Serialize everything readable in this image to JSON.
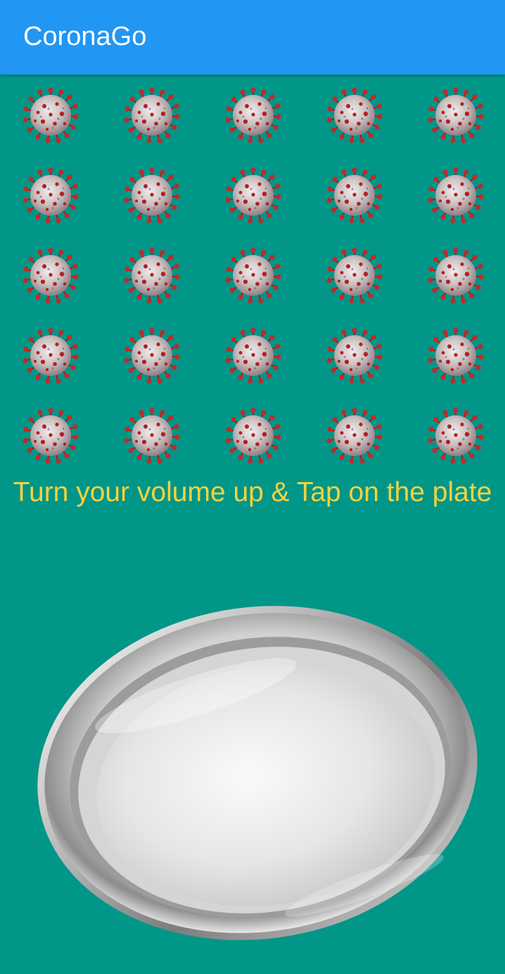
{
  "app_bar": {
    "title": "CoronaGo",
    "color": "#2196F3"
  },
  "background_color": "#009688",
  "virus_grid": {
    "rows": 5,
    "columns": 5,
    "icon": "coronavirus-icon",
    "count": 25
  },
  "instruction": {
    "text": "Turn your volume up & Tap on the plate",
    "color": "#F7D23E"
  },
  "plate": {
    "icon": "steel-plate-icon"
  }
}
